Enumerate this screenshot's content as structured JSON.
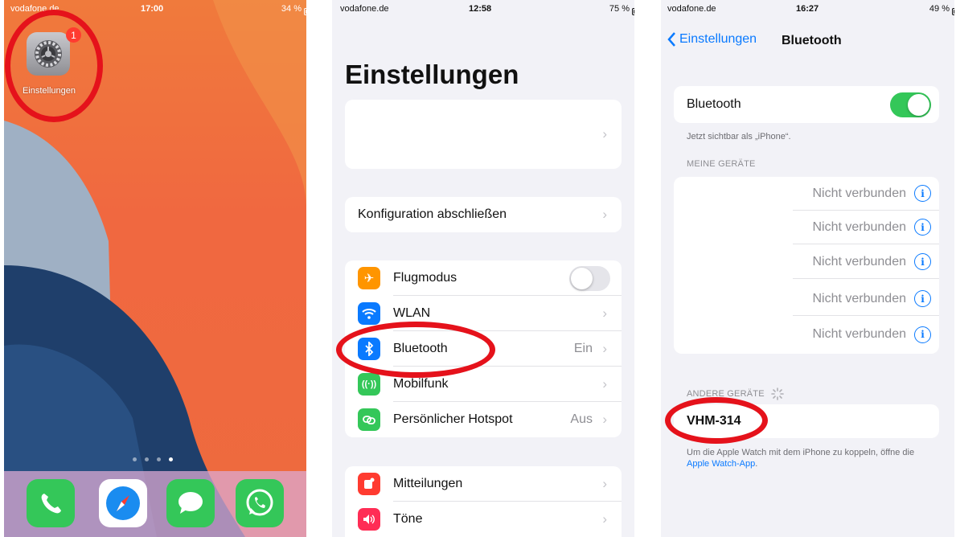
{
  "colors": {
    "accent": "#0a7aff",
    "highlight_ring": "#e5121b",
    "toggle_on": "#34c759",
    "badge": "#ff3b30"
  },
  "home": {
    "status": {
      "carrier": "vodafone.de",
      "time": "17:00",
      "battery": "34 %"
    },
    "settings_app": {
      "label": "Einstellungen",
      "badge": "1",
      "icon": "gear-icon"
    },
    "dock": [
      {
        "name": "phone-app",
        "icon": "phone-icon"
      },
      {
        "name": "safari-app",
        "icon": "compass-icon"
      },
      {
        "name": "messages-app",
        "icon": "message-bubble-icon"
      },
      {
        "name": "whatsapp-app",
        "icon": "whatsapp-icon"
      }
    ],
    "page_dots": 4,
    "active_page": 4
  },
  "settings": {
    "status": {
      "carrier": "vodafone.de",
      "time": "12:58",
      "battery": "75 %"
    },
    "title": "Einstellungen",
    "config_row": "Konfiguration abschließen",
    "rows": [
      {
        "label": "Flugmodus",
        "icon": "airplane-icon",
        "color": "#ff9500",
        "toggle": false
      },
      {
        "label": "WLAN",
        "icon": "wifi-icon",
        "color": "#0a7aff"
      },
      {
        "label": "Bluetooth",
        "icon": "bluetooth-icon",
        "color": "#0a7aff",
        "value": "Ein"
      },
      {
        "label": "Mobilfunk",
        "icon": "antenna-icon",
        "color": "#34c759"
      },
      {
        "label": "Persönlicher Hotspot",
        "icon": "hotspot-icon",
        "color": "#34c759",
        "value": "Aus"
      }
    ],
    "rows2": [
      {
        "label": "Mitteilungen",
        "icon": "notification-icon",
        "color": "#ff3b30"
      },
      {
        "label": "Töne",
        "icon": "speaker-icon",
        "color": "#ff2d55"
      }
    ]
  },
  "bluetooth": {
    "status": {
      "carrier": "vodafone.de",
      "time": "16:27",
      "battery": "49 %"
    },
    "back_label": "Einstellungen",
    "title": "Bluetooth",
    "toggle_label": "Bluetooth",
    "toggle_on": true,
    "visible_as": "Jetzt sichtbar als „iPhone“.",
    "my_devices_header": "MEINE GERÄTE",
    "my_devices": [
      "Nicht verbunden",
      "Nicht verbunden",
      "Nicht verbunden",
      "Nicht verbunden",
      "Nicht verbunden"
    ],
    "other_devices_header": "ANDERE GERÄTE",
    "other_device": "VHM-314",
    "footer_text": "Um die Apple Watch mit dem iPhone zu koppeln, öffne die",
    "footer_link": "Apple Watch-App",
    "footer_end": "."
  }
}
